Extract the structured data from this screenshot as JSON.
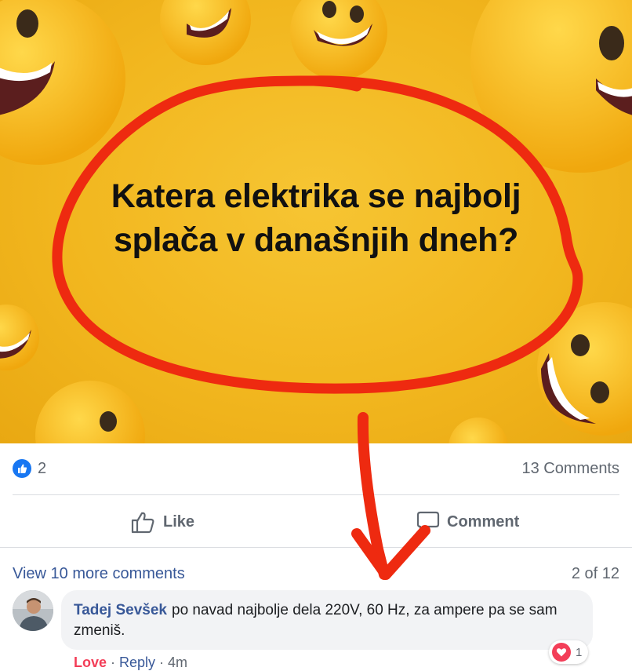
{
  "post": {
    "image_text_line1": "Katera elektrika se najbolj",
    "image_text_line2": "splača v današnjih dneh?",
    "background_color": "#f2b71f"
  },
  "stats": {
    "like_count": "2",
    "comments_label": "13 Comments"
  },
  "actions": {
    "like_label": "Like",
    "comment_label": "Comment"
  },
  "comments": {
    "view_more_label": "View 10 more comments",
    "pager_label": "2 of 12",
    "items": [
      {
        "author": "Tadej Sevšek",
        "text": "po navad najbolje dela 220V, 60 Hz, za ampere pa se sam zmeniš.",
        "reaction_count": "1",
        "meta": {
          "love": "Love",
          "separator1": " · ",
          "reply": "Reply",
          "separator2": " · ",
          "time": "4m"
        }
      }
    ]
  },
  "colors": {
    "facebook_blue": "#1877f2",
    "link_blue": "#385898",
    "love_red": "#f33e58",
    "annotation_red": "#ee2a10"
  },
  "icons": [
    "like-badge-icon",
    "thumbs-up-icon",
    "comment-icon",
    "love-reaction-icon",
    "avatar-photo"
  ]
}
